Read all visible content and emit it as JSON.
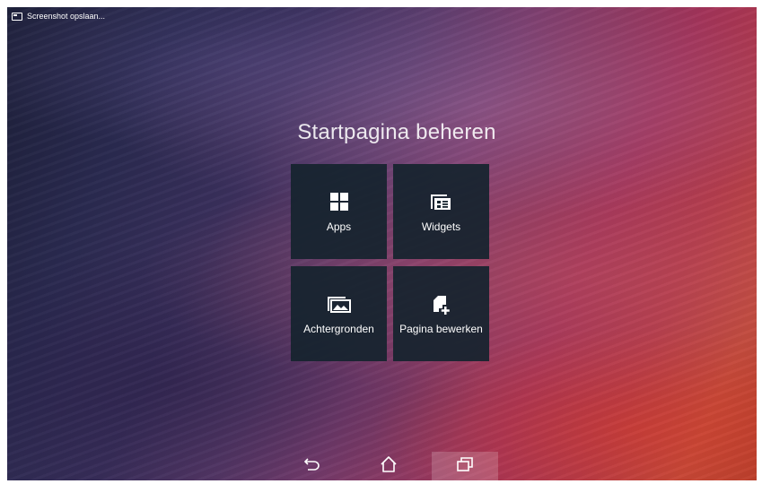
{
  "status_bar": {
    "notification_icon": "screenshot-icon",
    "notification_text": "Screenshot opslaan..."
  },
  "title": "Startpagina beheren",
  "tiles": [
    {
      "label": "Apps",
      "icon": "apps-grid-icon"
    },
    {
      "label": "Widgets",
      "icon": "widgets-icon"
    },
    {
      "label": "Achtergronden",
      "icon": "wallpaper-icon"
    },
    {
      "label": "Pagina bewerken",
      "icon": "edit-page-icon"
    }
  ],
  "nav_bar": {
    "back_icon": "back-icon",
    "home_icon": "home-icon",
    "recents_icon": "recents-icon"
  },
  "colors": {
    "tile_background": "#16242e",
    "text": "#ffffff"
  }
}
